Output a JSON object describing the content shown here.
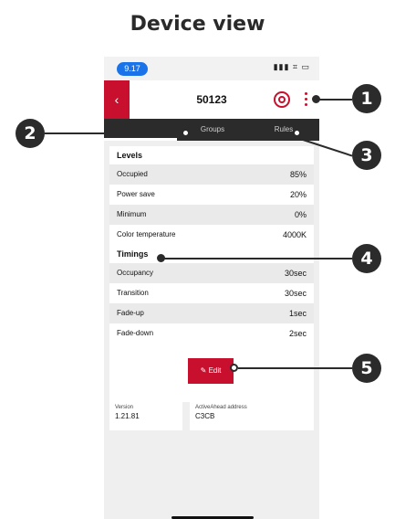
{
  "heading": "Device view",
  "status": {
    "time": "9.17",
    "icons": "▮▮▮ ⌗ ▭"
  },
  "appbar": {
    "title": "50123"
  },
  "tabs": [
    {
      "label": "Groups"
    },
    {
      "label": "Rules"
    }
  ],
  "levels": {
    "title": "Levels",
    "rows": [
      {
        "label": "Occupied",
        "value": "85%"
      },
      {
        "label": "Power save",
        "value": "20%"
      },
      {
        "label": "Minimum",
        "value": "0%"
      },
      {
        "label": "Color temperature",
        "value": "4000K"
      }
    ]
  },
  "timings": {
    "title": "Timings",
    "rows": [
      {
        "label": "Occupancy",
        "value": "30sec"
      },
      {
        "label": "Transition",
        "value": "30sec"
      },
      {
        "label": "Fade-up",
        "value": "1sec"
      },
      {
        "label": "Fade-down",
        "value": "2sec"
      }
    ]
  },
  "edit": {
    "label": "Edit"
  },
  "info": {
    "version_label": "Version",
    "version_value": "1.21.81",
    "address_label": "ActiveAhead address",
    "address_value": "C3CB"
  },
  "callouts": [
    "1",
    "2",
    "3",
    "4",
    "5"
  ],
  "colors": {
    "accent": "#c8102e",
    "dark": "#2b2b2b",
    "status_pill": "#1a73e8"
  }
}
